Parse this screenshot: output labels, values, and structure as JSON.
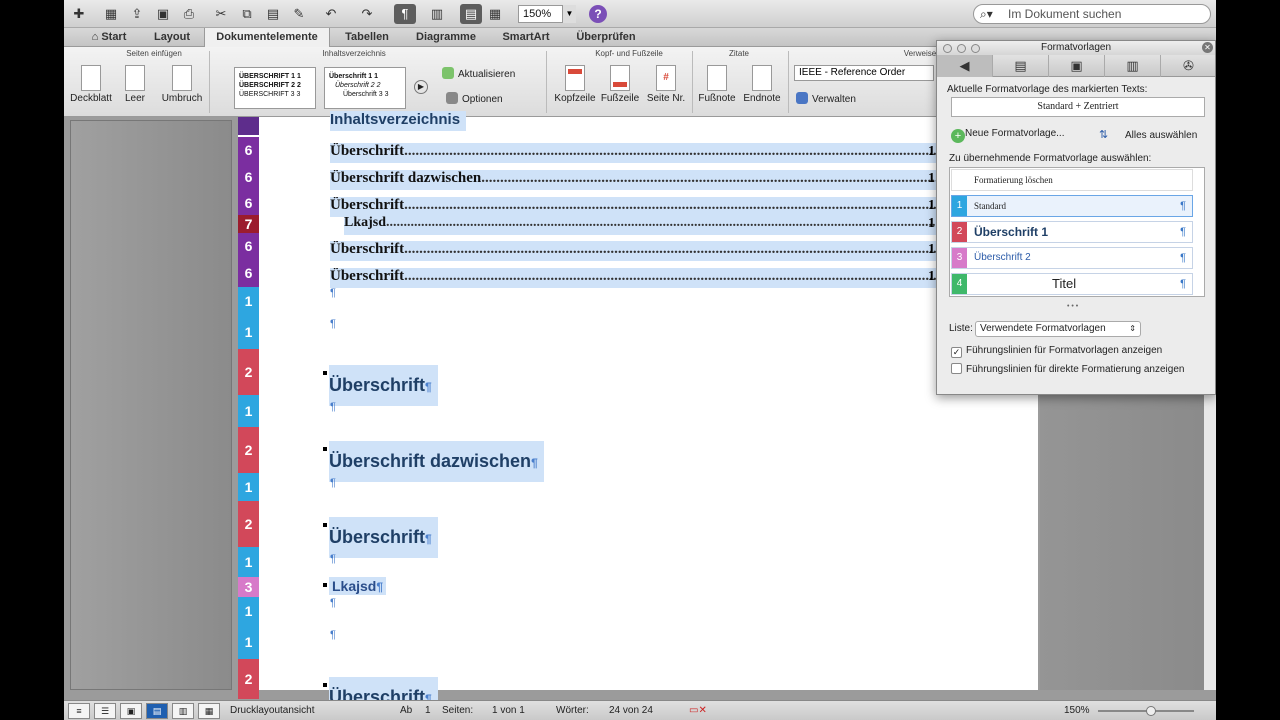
{
  "toolbar": {
    "zoom": "150%",
    "search_placeholder": "Im Dokument suchen",
    "help": "?"
  },
  "tabs": [
    {
      "label": "Start",
      "active": false
    },
    {
      "label": "Layout",
      "active": false
    },
    {
      "label": "Dokumentelemente",
      "active": true
    },
    {
      "label": "Tabellen",
      "active": false
    },
    {
      "label": "Diagramme",
      "active": false
    },
    {
      "label": "SmartArt",
      "active": false
    },
    {
      "label": "Überprüfen",
      "active": false
    }
  ],
  "ribbon": {
    "groups": {
      "seiten": "Seiten einfügen",
      "inhalt": "Inhaltsverzeichnis",
      "kopf": "Kopf- und Fußzeile",
      "zitate": "Zitate",
      "verweise": "Verweise"
    },
    "buttons": {
      "deckblatt": "Deckblatt",
      "leer": "Leer",
      "umbruch": "Umbruch",
      "aktualisieren": "Aktualisieren",
      "optionen": "Optionen",
      "kopfzeile": "Kopfzeile",
      "fusszeile": "Fußzeile",
      "seitenr": "Seite Nr.",
      "fussnote": "Fußnote",
      "endnote": "Endnote",
      "verwalten": "Verwalten"
    },
    "toc1": {
      "l1": "ÜBERSCHRIFT 1",
      "n1": "1",
      "l2": "ÜBERSCHRIFT 2",
      "n2": "2",
      "l3": "ÜBERSCHRIFT 3",
      "n3": "3"
    },
    "toc2": {
      "l1": "Überschrift 1",
      "n1": "1",
      "l2": "Überschrift 2",
      "n2": "2",
      "l3": "Überschrift 3",
      "n3": "3"
    },
    "citation_style": "IEEE - Reference Order"
  },
  "document": {
    "toc_heading": "Inhaltsverzeichnis",
    "toc_entries": [
      {
        "text": "Überschrift",
        "page": "1",
        "level": "6"
      },
      {
        "text": "Überschrift dazwischen",
        "page": "1",
        "level": "6"
      },
      {
        "text": "Überschrift",
        "page": "1",
        "level": "6"
      },
      {
        "text": "Lkajsd",
        "page": "1",
        "level": "7"
      },
      {
        "text": "Überschrift",
        "page": "1",
        "level": "6"
      },
      {
        "text": "Überschrift",
        "page": "1",
        "level": "6"
      }
    ],
    "body_headings": [
      "Überschrift",
      "Überschrift dazwischen",
      "Überschrift",
      "Lkajsd",
      "Überschrift"
    ],
    "style_bar": [
      "6",
      "6",
      "6",
      "7",
      "6",
      "6",
      "1",
      "1",
      "2",
      "1",
      "2",
      "1",
      "2",
      "1",
      "3",
      "1",
      "1",
      "2"
    ],
    "pilcrow": "¶"
  },
  "palette": {
    "title": "Formatvorlagen",
    "current_label": "Aktuelle Formatvorlage des markierten Texts:",
    "current_value": "Standard + Zentriert",
    "new_style": "Neue Formatvorlage...",
    "select_all": "Alles auswählen",
    "pick_label": "Zu übernehmende Formatvorlage auswählen:",
    "clear": "Formatierung löschen",
    "styles": [
      {
        "num": "1",
        "name": "Standard",
        "color": "#2ea6e0"
      },
      {
        "num": "2",
        "name": "Überschrift 1",
        "color": "#d2485a"
      },
      {
        "num": "3",
        "name": "Überschrift 2",
        "color": "#d77ac9"
      },
      {
        "num": "4",
        "name": "Titel",
        "color": "#3fb86a"
      }
    ],
    "list_label": "Liste:",
    "list_value": "Verwendete Formatvorlagen",
    "opt1": "Führungslinien für Formatvorlagen anzeigen",
    "opt2": "Führungslinien für direkte Formatierung anzeigen",
    "more": "• • •"
  },
  "status": {
    "view": "Drucklayoutansicht",
    "ab": "Ab",
    "ab_val": "1",
    "seiten": "Seiten:",
    "seiten_val": "1 von 1",
    "woerter": "Wörter:",
    "woerter_val": "24 von 24",
    "zoom": "150%"
  }
}
